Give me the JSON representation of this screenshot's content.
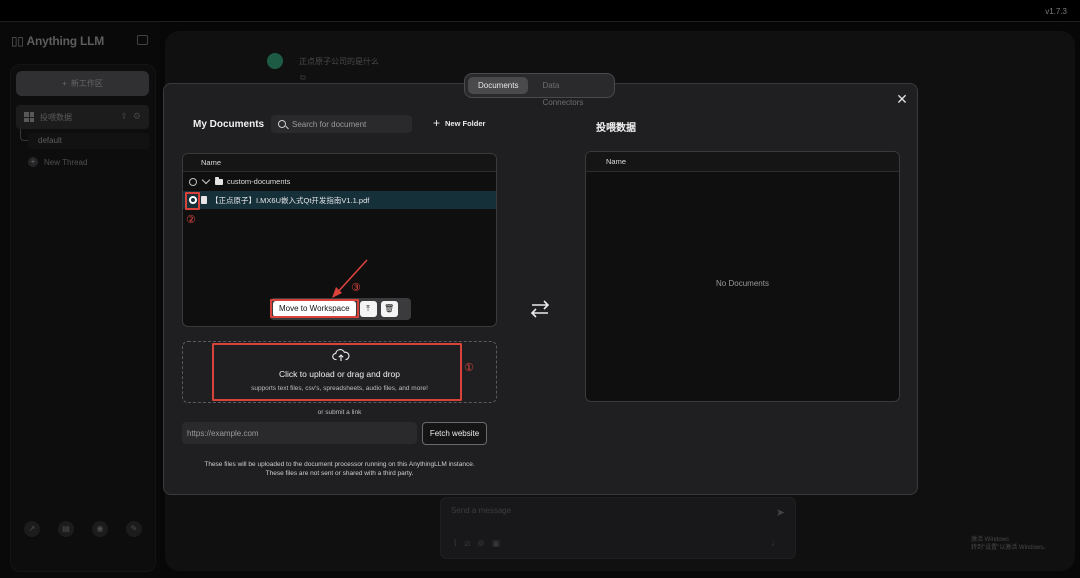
{
  "app": {
    "version": "v1.7.3",
    "logo_text": "Anything LLM"
  },
  "sidebar": {
    "new_workspace_label": "新工作区",
    "workspace_name": "投喂数据",
    "thread_default": "default",
    "new_thread_label": "New Thread",
    "footer_icons": [
      "analytics-icon",
      "book-icon",
      "discord-icon",
      "wrench-icon"
    ]
  },
  "chat": {
    "question": "正点原子公司的是什么",
    "prompt_placeholder": "Send a message"
  },
  "windows_watermark": {
    "line1": "激活 Windows",
    "line2": "转到\"设置\"以激活 Windows。"
  },
  "tabs": [
    {
      "label": "Documents"
    },
    {
      "label": "Data Connectors"
    }
  ],
  "modal": {
    "left_title": "My Documents",
    "search_placeholder": "Search for document",
    "new_folder_label": "New Folder",
    "file_header": "Name",
    "folder_name": "custom-documents",
    "file_name": "【正点原子】I.MX6U嵌入式Qt开发指南V1.1.pdf",
    "move_label": "Move to Workspace",
    "upload_title": "Click to upload or drag and drop",
    "upload_sub": "supports text files, csv's, spreadsheets, audio files, and more!",
    "or_link": "or submit a link",
    "url_placeholder": "https://example.com",
    "fetch_label": "Fetch website",
    "disclaimer_1": "These files will be uploaded to the document processor running on this AnythingLLM instance.",
    "disclaimer_2": "These files are not sent or shared with a third party.",
    "right_title": "投喂数据",
    "ws_header": "Name",
    "no_docs": "No Documents"
  },
  "annotations": {
    "one": "①",
    "two": "②",
    "three": "③"
  },
  "colors": {
    "accent_selected_row": "#16303a",
    "annotation_red": "#d9423a"
  }
}
